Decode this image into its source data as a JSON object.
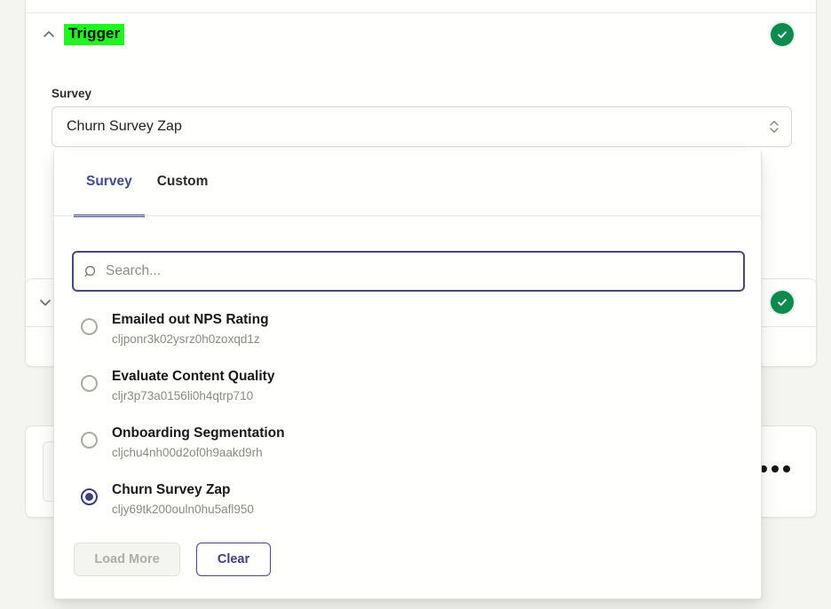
{
  "trigger_card": {
    "title": "Trigger",
    "collapse_icon": "chevron-up-icon",
    "status_icon": "check-circle-icon",
    "field": {
      "label": "Survey",
      "selected_value": "Churn Survey Zap",
      "caret_icon": "chevron-up-down-icon"
    }
  },
  "second_card": {
    "expand_icon": "chevron-down-icon",
    "status_icon": "check-circle-icon"
  },
  "bottom_card": {
    "overflow_icon": "ellipsis-horizontal-icon"
  },
  "dropdown": {
    "tabs": [
      {
        "label": "Survey",
        "active": true
      },
      {
        "label": "Custom",
        "active": false
      }
    ],
    "search": {
      "icon": "search-icon",
      "placeholder": "Search...",
      "value": ""
    },
    "options": [
      {
        "title": "Emailed out NPS Rating",
        "id": "cljponr3k02ysrz0h0zoxqd1z",
        "selected": false
      },
      {
        "title": "Evaluate Content Quality",
        "id": "cljr3p73a0156li0h4qtrp710",
        "selected": false
      },
      {
        "title": "Onboarding Segmentation",
        "id": "cljchu4nh00d2of0h9aakd9rh",
        "selected": false
      },
      {
        "title": "Churn Survey Zap",
        "id": "cljy69tk200ouln0hu5afl950",
        "selected": true
      }
    ],
    "footer": {
      "load_more_label": "Load More",
      "load_more_disabled": true,
      "clear_label": "Clear"
    }
  },
  "colors": {
    "accent_indigo": "#3b3f7a",
    "tab_active": "#434b8f",
    "status_green": "#0e8a4f",
    "highlight_green": "#21f521",
    "page_background": "#f4f4f1",
    "card_background": "#fffffd"
  }
}
